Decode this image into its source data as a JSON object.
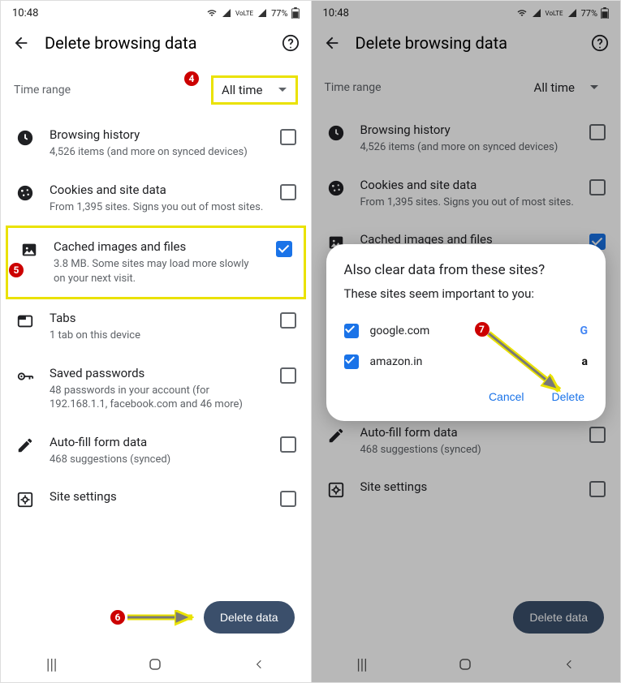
{
  "status": {
    "time": "10:48",
    "battery": "77%",
    "net": "VoLTE"
  },
  "header": {
    "title": "Delete browsing data"
  },
  "time_range": {
    "label": "Time range",
    "value": "All time"
  },
  "items": [
    {
      "title": "Browsing history",
      "sub": "4,526 items (and more on synced devices)",
      "icon": "clock"
    },
    {
      "title": "Cookies and site data",
      "sub": "From 1,395 sites. Signs you out of most sites.",
      "icon": "cookie"
    },
    {
      "title": "Cached images and files",
      "sub": "3.8 MB. Some sites may load more slowly on your next visit.",
      "icon": "image"
    },
    {
      "title": "Tabs",
      "sub": "1 tab on this device",
      "icon": "tab"
    },
    {
      "title": "Saved passwords",
      "sub": "48 passwords in your account (for 192.168.1.1, facebook.com and 46 more)",
      "icon": "key"
    },
    {
      "title": "Auto-fill form data",
      "sub": "468 suggestions (synced)",
      "icon": "pencil"
    },
    {
      "title": "Site settings",
      "sub": "",
      "icon": "settings-app"
    }
  ],
  "delete_btn": "Delete data",
  "dialog": {
    "line1": "Also clear data from these sites?",
    "line2": "These sites seem important to you:",
    "sites": [
      {
        "name": "google.com",
        "fav": "G",
        "fav_color": "#4285F4"
      },
      {
        "name": "amazon.in",
        "fav": "a",
        "fav_color": "#111"
      }
    ],
    "cancel": "Cancel",
    "delete": "Delete"
  },
  "steps": {
    "s4": "4",
    "s5": "5",
    "s6": "6",
    "s7": "7"
  }
}
